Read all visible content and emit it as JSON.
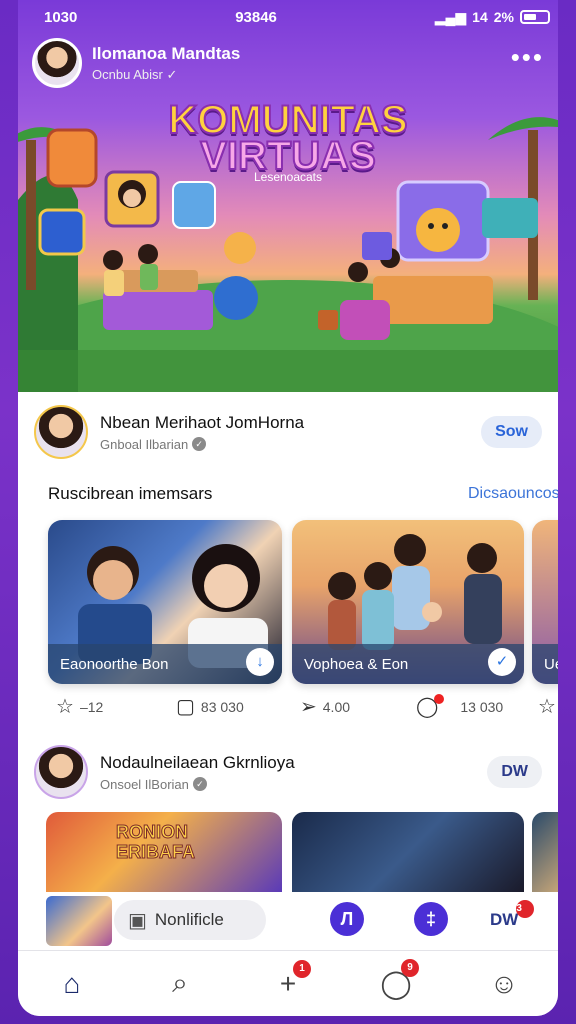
{
  "status": {
    "time": "1030",
    "center": "93846",
    "signal": "14",
    "battery_pct": "2%"
  },
  "hero": {
    "profile_name": "Ilomanoa Mandtas",
    "profile_sub": "Ocnbu Abisr",
    "title_line1": "KOMUNITAS",
    "title_line2": "VIRTUAS",
    "tagline": "Lesenoacats"
  },
  "post1": {
    "name": "Nbean Merihaot JomHorna",
    "sub": "Gnboal Ilbarian",
    "follow_label": "Sow",
    "section_title": "Ruscibrean imemsars",
    "section_link": "Dicsaouncos",
    "cards": [
      {
        "label": "Eaonoorthe Bon",
        "badge": "↓"
      },
      {
        "label": "Vophoea & Eon",
        "badge": "✓"
      },
      {
        "label": "Ue"
      }
    ],
    "stats": {
      "likes": "–12",
      "comments": "83 030",
      "shares": "4.00",
      "reactions": "13 030"
    }
  },
  "post2": {
    "name": "Nodaulneilaean Gkrnlioya",
    "sub": "Onsoel IlBorian",
    "follow_label": "DW",
    "card_text": "RONION ERIBAFA"
  },
  "bottom_bar": {
    "pill_label": "Nonlificle",
    "button1": "Л",
    "button2": "‡",
    "link_label": "DW",
    "link_badge": "3"
  },
  "tabs": {
    "home": "⌂",
    "search": "⌕",
    "add": "+",
    "add_badge": "1",
    "chat_badge": "9"
  }
}
